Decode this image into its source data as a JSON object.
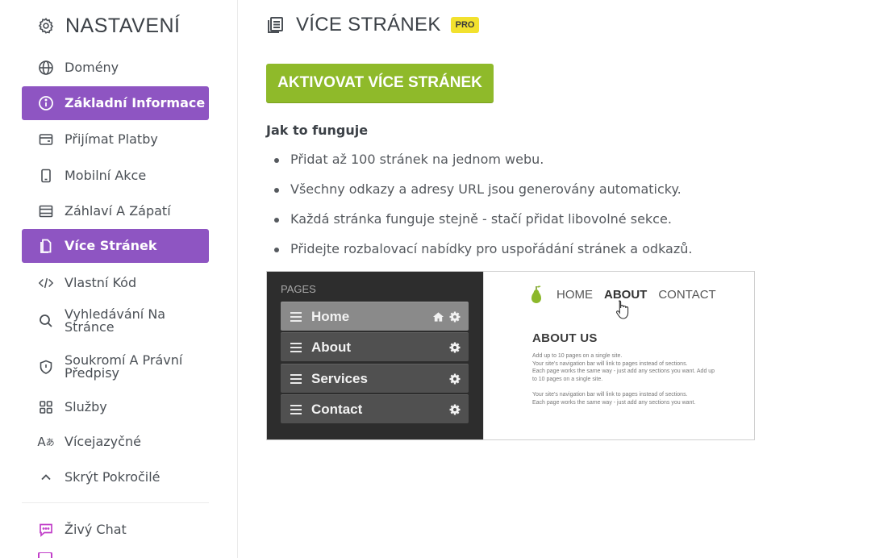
{
  "sidebar": {
    "title": "NASTAVENÍ",
    "items": [
      {
        "label": "Domény",
        "icon": "globe-icon"
      },
      {
        "label": "Základní Informace",
        "icon": "info-icon",
        "active": true
      },
      {
        "label": "Přijímat Platby",
        "icon": "wallet-icon"
      },
      {
        "label": "Mobilní Akce",
        "icon": "phone-icon"
      },
      {
        "label": "Záhlaví A Zápatí",
        "icon": "layout-icon"
      },
      {
        "label": "Více Stránek",
        "icon": "page-icon",
        "active": true
      },
      {
        "label": "Vlastní Kód",
        "icon": "code-icon"
      },
      {
        "label": "Vyhledávání Na Stránce",
        "icon": "search-icon"
      },
      {
        "label": "Soukromí A Právní Předpisy",
        "icon": "shield-icon"
      },
      {
        "label": "Služby",
        "icon": "apps-icon"
      },
      {
        "label": "Vícejazyčné",
        "icon": "translate-icon"
      },
      {
        "label": "Skrýt Pokročilé",
        "icon": "chevron-up-icon"
      },
      {
        "label": "Živý Chat",
        "icon": "chat-icon"
      }
    ],
    "accent": "#8e55c2"
  },
  "main": {
    "title": "VÍCE STRÁNEK",
    "badge": "PRO",
    "activate_label": "AKTIVOVAT VÍCE STRÁNEK",
    "how_heading": "Jak to funguje",
    "bullets": [
      "Přidat až 100 stránek na jednom webu.",
      "Všechny odkazy a adresy URL jsou generovány automaticky.",
      "Každá stránka funguje stejně - stačí přidat libovolné sekce.",
      "Přidejte rozbalovací nabídky pro uspořádání stránek a odkazů."
    ],
    "button_color": "#8fba2a",
    "badge_color": "#f2e12e"
  },
  "preview": {
    "pages_label": "PAGES",
    "pages": [
      "Home",
      "About",
      "Services",
      "Contact"
    ],
    "nav": [
      "HOME",
      "ABOUT",
      "CONTACT"
    ],
    "heading": "ABOUT US",
    "paragraphs": [
      [
        "Add up to 10 pages on a single site.",
        "Your site's navigation bar will link to pages instead of sections.",
        "Each page works the same way - just add any sections you want. Add up to 10 pages on a single site."
      ],
      [
        "Your site's navigation bar will link to pages instead of sections.",
        "Each page works the same way - just add any sections you want."
      ]
    ]
  }
}
